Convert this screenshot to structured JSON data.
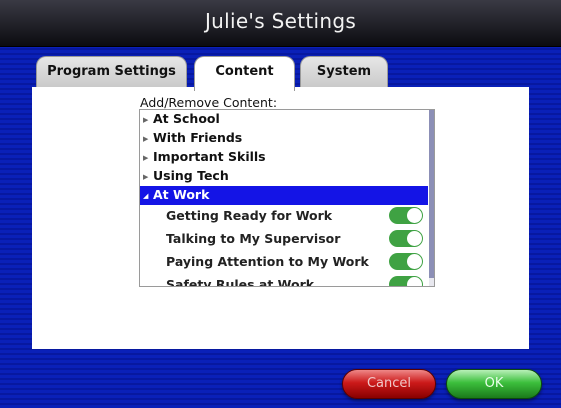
{
  "window": {
    "title": "Julie's Settings"
  },
  "tabs": [
    {
      "label": "Program Settings",
      "active": false
    },
    {
      "label": "Content",
      "active": true
    },
    {
      "label": "System",
      "active": false
    }
  ],
  "content": {
    "label": "Add/Remove Content:",
    "categories": [
      {
        "label": "At School",
        "expanded": false
      },
      {
        "label": "With Friends",
        "expanded": false
      },
      {
        "label": "Important Skills",
        "expanded": false
      },
      {
        "label": "Using Tech",
        "expanded": false
      },
      {
        "label": "At Work",
        "expanded": true,
        "selected": true
      }
    ],
    "items": [
      {
        "label": "Getting Ready for Work",
        "enabled": true
      },
      {
        "label": "Talking to My Supervisor",
        "enabled": true
      },
      {
        "label": "Paying Attention to My Work",
        "enabled": true
      },
      {
        "label": "Safety Rules at Work",
        "enabled": true
      }
    ]
  },
  "buttons": {
    "cancel": "Cancel",
    "ok": "OK"
  },
  "icons": {
    "collapsed": "triangle-right-icon",
    "expanded": "triangle-down-icon"
  },
  "colors": {
    "background": "#0a20b8",
    "selection": "#1414e6",
    "toggle_on": "#3fa243",
    "cancel": "#cc1a1a",
    "ok": "#3cbf3c"
  }
}
